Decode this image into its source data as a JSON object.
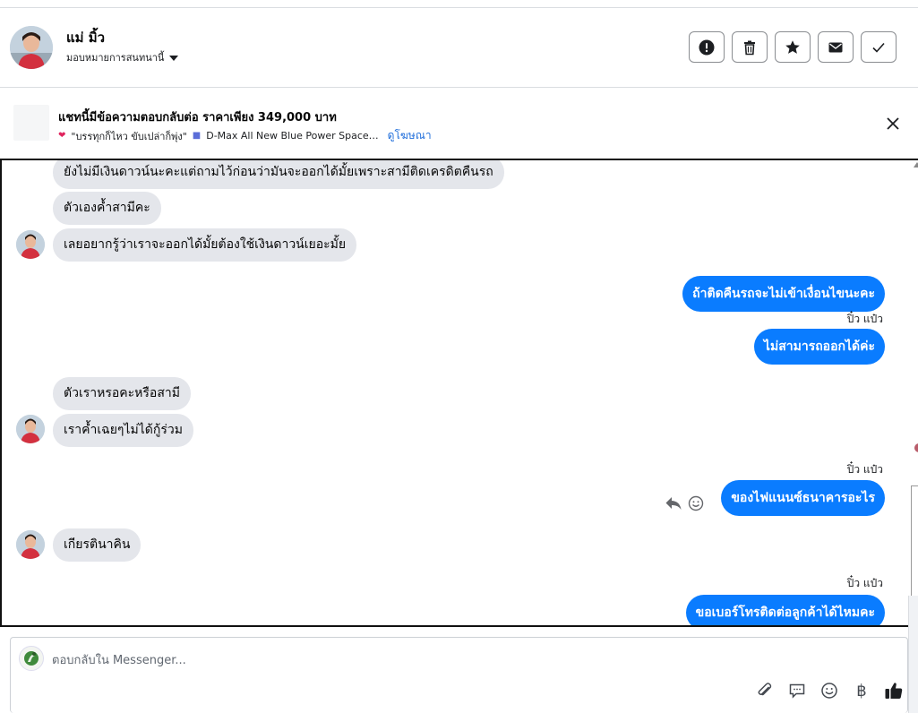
{
  "header": {
    "name": "แม่ มิ้ว",
    "assign_label": "มอบหมายการสนทนานี้",
    "buttons": [
      {
        "name": "mark-spam-button",
        "icon": "exclamation-icon"
      },
      {
        "name": "delete-button",
        "icon": "trash-icon"
      },
      {
        "name": "star-button",
        "icon": "star-icon"
      },
      {
        "name": "mark-unread-button",
        "icon": "envelope-icon"
      },
      {
        "name": "mark-done-button",
        "icon": "check-icon"
      }
    ]
  },
  "ad": {
    "title": "แชทนี้มีข้อความตอบกลับต่อ ราคาเพียง 349,000 บาท",
    "quote": "\"บรรทุกก็ไหว ขับเปล่าก็พุ่ง\"",
    "product": "D-Max All New Blue Power Space…",
    "link": "ดูโฆษณา"
  },
  "conversation": {
    "incoming_1": "ยังไม่มีเงินดาวน์นะคะแต่ถามไว้ก่อนว่ามันจะออกได้มั้ยเพราะสามีติดเครดิตคืนรถ",
    "incoming_2": "ตัวเองค้ำสามีคะ",
    "incoming_3": "เลยอยากรู้ว่าเราจะออกได้มั้ยต้องใช้เงินดาวน์เยอะมั้ย",
    "outgoing_1": "ถ้าติดคืนรถจะไม่เข้าเงื่อนไขนะคะ",
    "sender_1": "ปิ๋ว แป๋ว",
    "outgoing_2": "ไม่สามารถออกได้ค่ะ",
    "incoming_4": "ตัวเราหรอคะหรือสามี",
    "incoming_5": "เราค้ำเฉยๆไม่ได้กู้ร่วม",
    "sender_2": "ปิ๋ว แป๋ว",
    "outgoing_3": "ของไฟแนนซ์ธนาคารอะไร",
    "incoming_6": "เกียรตินาคิน",
    "sender_3": "ปิ๋ว แป๋ว",
    "outgoing_4": "ขอเบอร์โทรติดต่อลูกค้าได้ไหมคะ"
  },
  "composer": {
    "placeholder": "ตอบกลับใน Messenger...",
    "tools": [
      "paperclip-icon",
      "saved-replies-icon",
      "emoji-icon",
      "baht-icon",
      "thumbs-up-icon"
    ],
    "baht_symbol": "฿"
  },
  "colors": {
    "outgoing_bubble": "#0a7cff",
    "incoming_bubble": "#e4e6eb",
    "link": "#216fdb"
  }
}
